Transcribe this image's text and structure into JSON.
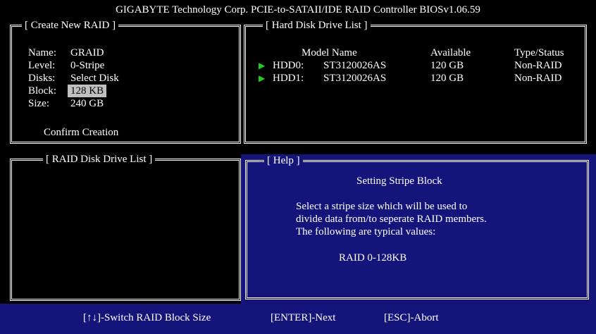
{
  "title": "GIGABYTE Technology Corp. PCIE-to-SATAII/IDE RAID Controller BIOSv1.06.59",
  "create_panel": {
    "title": "[ Create New RAID ]",
    "fields": [
      {
        "label": "Name:",
        "value": "GRAID"
      },
      {
        "label": "Level:",
        "value": "0-Stripe"
      },
      {
        "label": "Disks:",
        "value": "Select Disk"
      },
      {
        "label": "Block:",
        "value": "128 KB"
      },
      {
        "label": "Size:",
        "value": "240 GB"
      }
    ],
    "confirm": "Confirm Creation"
  },
  "hdd_panel": {
    "title": "[ Hard Disk Drive List ]",
    "headers": {
      "model": "Model Name",
      "available": "Available",
      "type": "Type/Status"
    },
    "rows": [
      {
        "name": "HDD0:",
        "model": "ST3120026AS",
        "available": "120 GB",
        "type": "Non-RAID"
      },
      {
        "name": "HDD1:",
        "model": "ST3120026AS",
        "available": "120 GB",
        "type": "Non-RAID"
      }
    ]
  },
  "raid_list_panel": {
    "title": "[ RAID Disk Drive List ]"
  },
  "help_panel": {
    "title": "[ Help ]",
    "heading": "Setting Stripe Block",
    "lines": [
      "Select a stripe size which will be used to",
      "divide data from/to seperate RAID members.",
      "The following are typical values:"
    ],
    "value_line": "RAID 0-128KB"
  },
  "footer": {
    "switch": "[↑↓]-Switch RAID Block Size",
    "next": "[ENTER]-Next",
    "abort": "[ESC]-Abort"
  },
  "colors": {
    "help_bg": "#14147a",
    "selected_bg": "#c0c0c0",
    "arrow": "#22cc22"
  }
}
